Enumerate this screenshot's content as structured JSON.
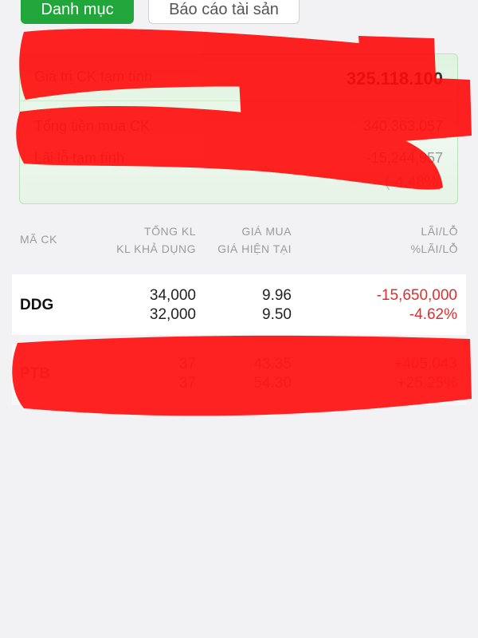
{
  "tabs": {
    "active_label": "Danh mục",
    "report_label": "Báo cáo tài sản"
  },
  "summary": {
    "rows": [
      {
        "label": "Giá trị CK tạm tính",
        "value": "325.118.100"
      },
      {
        "label": "Tổng tiền mua CK",
        "value": "340.363.057"
      },
      {
        "label": "Lãi lỗ tạm tính",
        "value": "-15,244,957"
      }
    ],
    "percent": "(-4.48%)"
  },
  "columns": {
    "symbol": "MÃ CK",
    "total_qty": "TỔNG KL",
    "avail_qty": "KL KHẢ DỤNG",
    "buy_price": "GIÁ MUA",
    "cur_price": "GIÁ HIỆN TẠI",
    "pl": "LÃI/LỖ",
    "pl_pct": "%LÃI/LỖ"
  },
  "holdings": [
    {
      "symbol": "DDG",
      "total_qty": "34,000",
      "avail_qty": "32,000",
      "buy_price": "9.96",
      "cur_price": "9.50",
      "pl": "-15,650,000",
      "pl_pct": "-4.62%"
    },
    {
      "symbol": "PTB",
      "total_qty": "37",
      "avail_qty": "37",
      "buy_price": "43.35",
      "cur_price": "54.30",
      "pl": "+405,043",
      "pl_pct": "+25.25%"
    }
  ],
  "colors": {
    "accent": "#21a63c",
    "loss": "#d93131",
    "redaction": "#ff0000"
  }
}
